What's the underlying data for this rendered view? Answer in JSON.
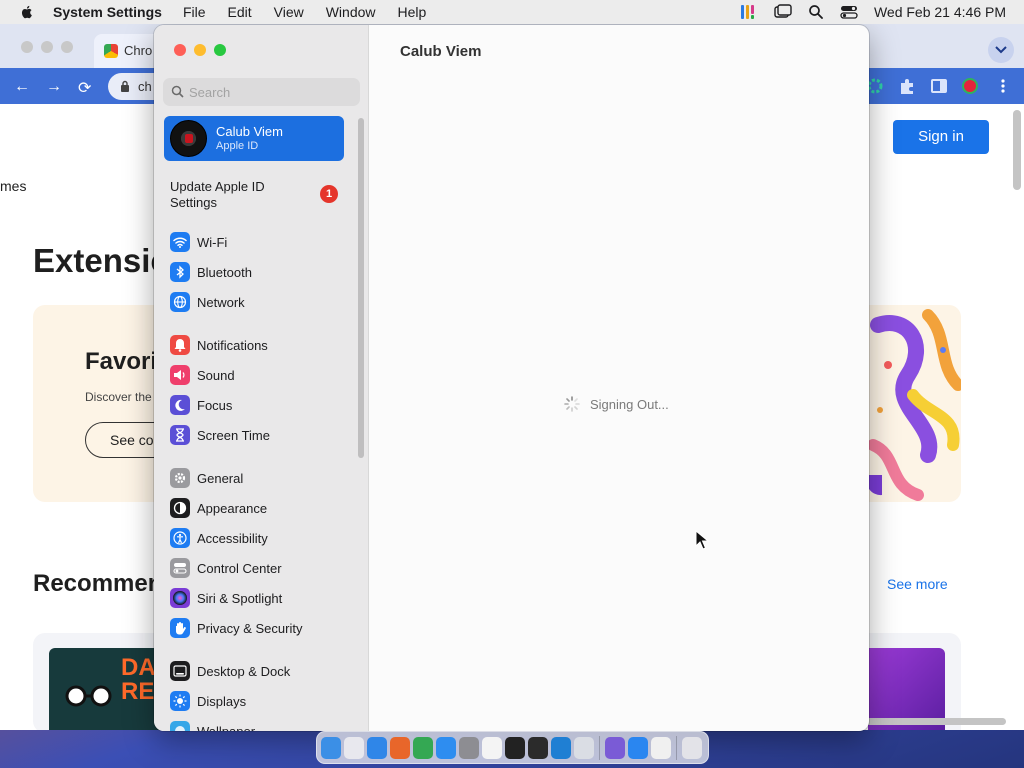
{
  "menubar": {
    "app_name": "System Settings",
    "menus": [
      "File",
      "Edit",
      "View",
      "Window",
      "Help"
    ],
    "clock": "Wed Feb 21  4:46 PM"
  },
  "browser": {
    "tab_title": "Chro",
    "omnibox_text": "ch",
    "signin_label": "Sign in",
    "nav_fragment": "mes",
    "heading_fragment": "Extensio",
    "hero_title_fragment": "Favori",
    "hero_text_fragment": "Discover the",
    "hero_button_fragment": "See co",
    "section_fragment": "Recommen",
    "see_more": "See more",
    "card_text_fragment": "DA RE"
  },
  "settings": {
    "search_placeholder": "Search",
    "account": {
      "name": "Calub Viem",
      "subtitle": "Apple ID"
    },
    "update_label": "Update Apple ID Settings",
    "update_badge": "1",
    "groups": [
      [
        {
          "label": "Wi-Fi",
          "icon": "wifi-icon",
          "color": "#1e7cf2"
        },
        {
          "label": "Bluetooth",
          "icon": "bluetooth-icon",
          "color": "#1e7cf2"
        },
        {
          "label": "Network",
          "icon": "globe-icon",
          "color": "#1e7cf2"
        }
      ],
      [
        {
          "label": "Notifications",
          "icon": "bell-icon",
          "color": "#ef4a43"
        },
        {
          "label": "Sound",
          "icon": "speaker-icon",
          "color": "#ef3f6c"
        },
        {
          "label": "Focus",
          "icon": "moon-icon",
          "color": "#5b4fd6"
        },
        {
          "label": "Screen Time",
          "icon": "hourglass-icon",
          "color": "#5b4fd6"
        }
      ],
      [
        {
          "label": "General",
          "icon": "gear-icon",
          "color": "#9a9a9e"
        },
        {
          "label": "Appearance",
          "icon": "appearance-icon",
          "color": "#1d1d1f"
        },
        {
          "label": "Accessibility",
          "icon": "accessibility-icon",
          "color": "#1e7cf2"
        },
        {
          "label": "Control Center",
          "icon": "toggles-icon",
          "color": "#9a9a9e"
        },
        {
          "label": "Siri & Spotlight",
          "icon": "siri-icon",
          "color": "#7a3cd6"
        },
        {
          "label": "Privacy & Security",
          "icon": "hand-icon",
          "color": "#1e7cf2"
        }
      ],
      [
        {
          "label": "Desktop & Dock",
          "icon": "dock-icon",
          "color": "#1d1d1f"
        },
        {
          "label": "Displays",
          "icon": "sun-icon",
          "color": "#1e7cf2"
        },
        {
          "label": "Wallpaper",
          "icon": "wallpaper-icon",
          "color": "#35a7e8"
        }
      ]
    ],
    "content_title": "Calub Viem",
    "status_text": "Signing Out..."
  },
  "dock": {
    "apps": [
      {
        "name": "finder-icon",
        "color": "#3b8fe6"
      },
      {
        "name": "launchpad-icon",
        "color": "#e8e8ee"
      },
      {
        "name": "safari-icon",
        "color": "#2f86e8"
      },
      {
        "name": "firefox-icon",
        "color": "#e8662a"
      },
      {
        "name": "chrome-icon",
        "color": "#34a853"
      },
      {
        "name": "app-store-icon",
        "color": "#2e8df0"
      },
      {
        "name": "settings-icon",
        "color": "#8d8d92"
      },
      {
        "name": "textedit-icon",
        "color": "#f4f4f4"
      },
      {
        "name": "terminal-icon",
        "color": "#222222"
      },
      {
        "name": "brush-icon",
        "color": "#2b2b2b"
      },
      {
        "name": "vscode-icon",
        "color": "#1f7fd3"
      },
      {
        "name": "preview-icon",
        "color": "#dadde4"
      },
      {
        "name": "visual-studio-icon",
        "color": "#7a5bd6"
      },
      {
        "name": "mail-icon",
        "color": "#2a86f0"
      },
      {
        "name": "grid-icon",
        "color": "#f0f0f0"
      },
      {
        "name": "trash-icon",
        "color": "#e3e3e8"
      }
    ]
  }
}
